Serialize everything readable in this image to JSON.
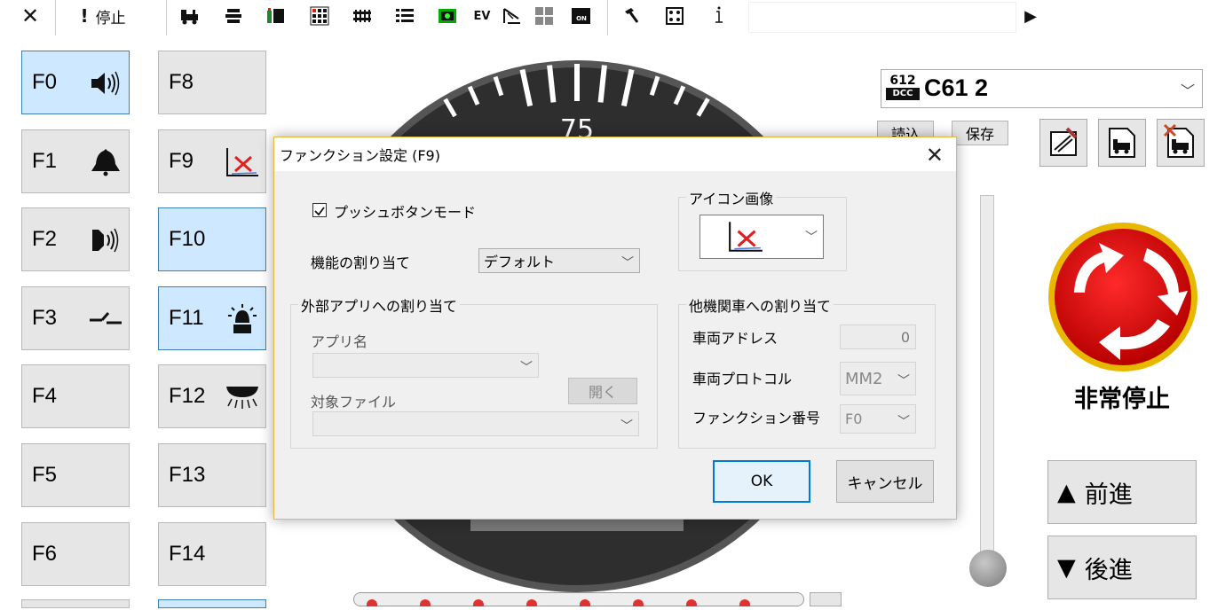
{
  "toolbar": {
    "close_glyph": "✕",
    "stop_label": "停止",
    "icons": [
      "locomotive-icon",
      "train-list-icon",
      "accessory-icon",
      "layout-panel-icon",
      "track-icon",
      "list-icon",
      "signal-board-icon",
      "ev-icon",
      "crane-icon",
      "grid-icon",
      "power-on-icon",
      "tool-icon",
      "dice-icon",
      "info-icon"
    ],
    "ev_label": "EV",
    "command_value": "",
    "run_glyph": "▶"
  },
  "functions": {
    "left": [
      {
        "label": "F0",
        "on": true,
        "icon": "speaker-icon"
      },
      {
        "label": "F1",
        "on": false,
        "icon": "bell-icon"
      },
      {
        "label": "F2",
        "on": false,
        "icon": "horn-icon"
      },
      {
        "label": "F3",
        "on": false,
        "icon": "coupler-icon"
      },
      {
        "label": "F4",
        "on": false,
        "icon": ""
      },
      {
        "label": "F5",
        "on": false,
        "icon": ""
      },
      {
        "label": "F6",
        "on": false,
        "icon": ""
      }
    ],
    "right": [
      {
        "label": "F8",
        "on": false,
        "icon": ""
      },
      {
        "label": "F9",
        "on": false,
        "icon": "disabled-function-icon"
      },
      {
        "label": "F10",
        "on": true,
        "icon": ""
      },
      {
        "label": "F11",
        "on": true,
        "icon": "beacon-icon"
      },
      {
        "label": "F12",
        "on": false,
        "icon": "headlight-icon"
      },
      {
        "label": "F13",
        "on": false,
        "icon": ""
      },
      {
        "label": "F14",
        "on": false,
        "icon": ""
      }
    ]
  },
  "gauge": {
    "label_75": "75"
  },
  "loco": {
    "protocol_badge_top": "612",
    "protocol_badge_bottom": "DCC",
    "name": "C61 2",
    "read_label": "読込",
    "save_label": "保存"
  },
  "emergency": {
    "label": "非常停止",
    "color": "#e00000",
    "ring": "#e8b800"
  },
  "direction": {
    "forward_label": "前進",
    "reverse_label": "後進"
  },
  "dialog": {
    "title": "ファンクション設定 (F9)",
    "push_mode_label": "プッシュボタンモード",
    "push_mode_checked": true,
    "assign_label": "機能の割り当て",
    "assign_value": "デフォルト",
    "ext_group_label": "外部アプリへの割り当て",
    "app_name_label": "アプリ名",
    "app_name_value": "",
    "target_file_label": "対象ファイル",
    "target_file_value": "",
    "open_label": "開く",
    "icon_group_label": "アイコン画像",
    "other_group_label": "他機関車への割り当て",
    "address_label": "車両アドレス",
    "address_value": "0",
    "protocol_label": "車両プロトコル",
    "protocol_value": "MM2",
    "fn_number_label": "ファンクション番号",
    "fn_number_value": "F0",
    "ok_label": "OK",
    "cancel_label": "キャンセル"
  }
}
